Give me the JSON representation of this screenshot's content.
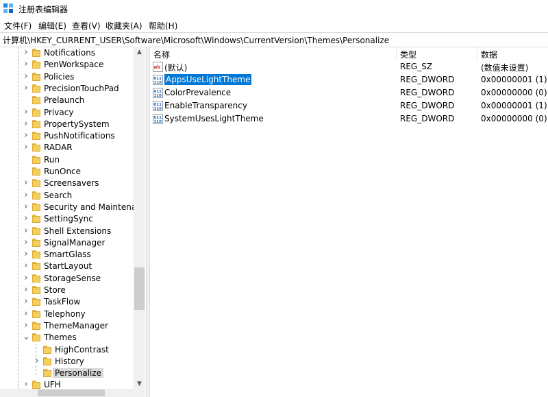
{
  "window": {
    "title": "注册表编辑器"
  },
  "menu": [
    "文件(F)",
    "编辑(E)",
    "查看(V)",
    "收藏夹(A)",
    "帮助(H)"
  ],
  "address": "计算机\\HKEY_CURRENT_USER\\Software\\Microsoft\\Windows\\CurrentVersion\\Themes\\Personalize",
  "tree": {
    "items": [
      {
        "label": "Notifications",
        "expandable": true
      },
      {
        "label": "PenWorkspace",
        "expandable": true
      },
      {
        "label": "Policies",
        "expandable": true
      },
      {
        "label": "PrecisionTouchPad",
        "expandable": true
      },
      {
        "label": "Prelaunch",
        "expandable": false
      },
      {
        "label": "Privacy",
        "expandable": true
      },
      {
        "label": "PropertySystem",
        "expandable": true
      },
      {
        "label": "PushNotifications",
        "expandable": true
      },
      {
        "label": "RADAR",
        "expandable": true
      },
      {
        "label": "Run",
        "expandable": false
      },
      {
        "label": "RunOnce",
        "expandable": false
      },
      {
        "label": "Screensavers",
        "expandable": true
      },
      {
        "label": "Search",
        "expandable": true
      },
      {
        "label": "Security and Maintenan",
        "expandable": true
      },
      {
        "label": "SettingSync",
        "expandable": true
      },
      {
        "label": "Shell Extensions",
        "expandable": true
      },
      {
        "label": "SignalManager",
        "expandable": true
      },
      {
        "label": "SmartGlass",
        "expandable": true
      },
      {
        "label": "StartLayout",
        "expandable": true
      },
      {
        "label": "StorageSense",
        "expandable": true
      },
      {
        "label": "Store",
        "expandable": true
      },
      {
        "label": "TaskFlow",
        "expandable": true
      },
      {
        "label": "Telephony",
        "expandable": true
      },
      {
        "label": "ThemeManager",
        "expandable": true
      },
      {
        "label": "Themes",
        "expandable": true,
        "expanded": true
      },
      {
        "label": "HighContrast",
        "expandable": false,
        "child": true
      },
      {
        "label": "History",
        "expandable": true,
        "child": true
      },
      {
        "label": "Personalize",
        "expandable": false,
        "child": true,
        "selected": true
      },
      {
        "label": "UFH",
        "expandable": true
      }
    ]
  },
  "list": {
    "columns": [
      "名称",
      "类型",
      "数据"
    ],
    "rows": [
      {
        "name": "(默认)",
        "type": "REG_SZ",
        "data": "(数值未设置)",
        "icon": "string-value-icon"
      },
      {
        "name": "AppsUseLightTheme",
        "type": "REG_DWORD",
        "data": "0x00000001 (1)",
        "icon": "dword-value-icon",
        "selected": true
      },
      {
        "name": "ColorPrevalence",
        "type": "REG_DWORD",
        "data": "0x00000000 (0)",
        "icon": "dword-value-icon"
      },
      {
        "name": "EnableTransparency",
        "type": "REG_DWORD",
        "data": "0x00000001 (1)",
        "icon": "dword-value-icon"
      },
      {
        "name": "SystemUsesLightTheme",
        "type": "REG_DWORD",
        "data": "0x00000000 (0)",
        "icon": "dword-value-icon"
      }
    ]
  },
  "colors": {
    "selection": "#0078d7",
    "folder": "#f5cf5b"
  }
}
